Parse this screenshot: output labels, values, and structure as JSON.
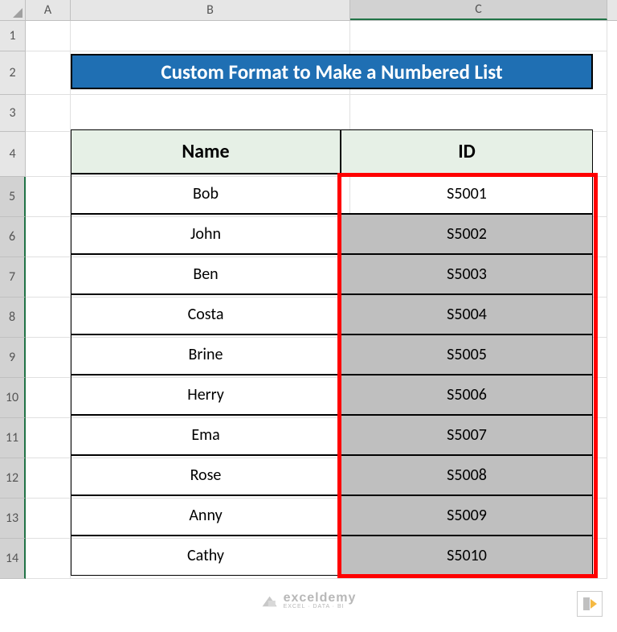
{
  "columns": [
    "A",
    "B",
    "C"
  ],
  "rows": [
    "1",
    "2",
    "3",
    "4",
    "5",
    "6",
    "7",
    "8",
    "9",
    "10",
    "11",
    "12",
    "13",
    "14"
  ],
  "selected_col_index": 2,
  "selected_row_start": 4,
  "selected_row_end": 13,
  "title": "Custom Format to Make a Numbered List",
  "headers": {
    "name": "Name",
    "id": "ID"
  },
  "data": [
    {
      "name": "Bob",
      "id": "S5001"
    },
    {
      "name": "John",
      "id": "S5002"
    },
    {
      "name": "Ben",
      "id": "S5003"
    },
    {
      "name": "Costa",
      "id": "S5004"
    },
    {
      "name": "Brine",
      "id": "S5005"
    },
    {
      "name": "Herry",
      "id": "S5006"
    },
    {
      "name": "Ema",
      "id": "S5007"
    },
    {
      "name": "Rose",
      "id": "S5008"
    },
    {
      "name": "Anny",
      "id": "S5009"
    },
    {
      "name": "Cathy",
      "id": "S5010"
    }
  ],
  "watermark": {
    "brand": "exceldemy",
    "sub": "EXCEL · DATA · BI"
  }
}
